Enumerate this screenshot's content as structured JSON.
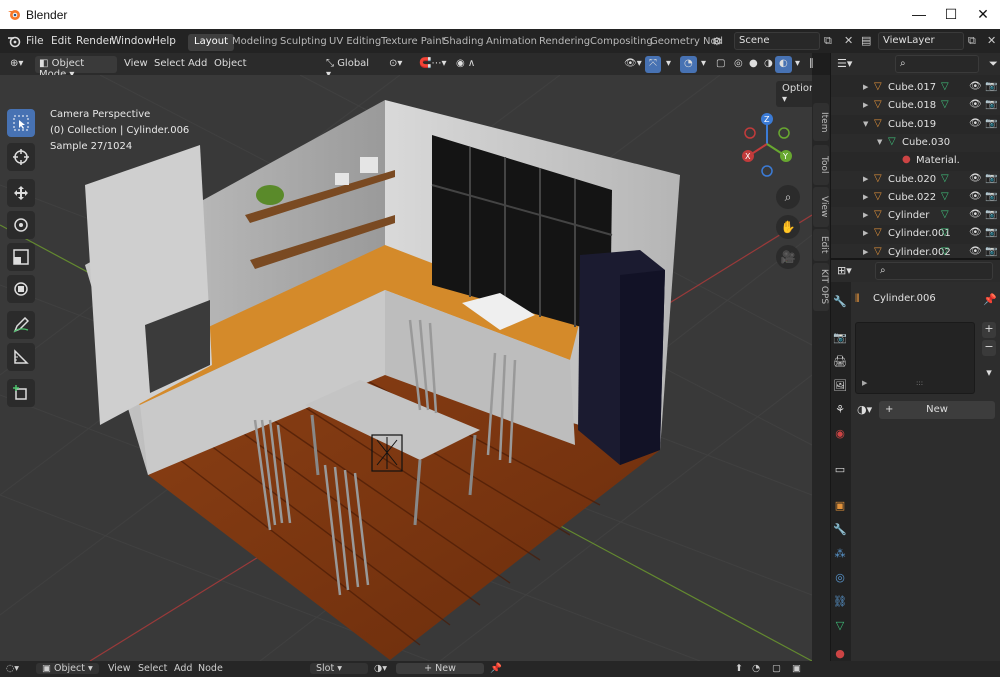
{
  "window": {
    "title": "Blender",
    "minimize": "—",
    "maximize": "☐",
    "close": "✕"
  },
  "menu": [
    "File",
    "Edit",
    "Render",
    "Window",
    "Help"
  ],
  "workspaces": [
    "Layout",
    "Modeling",
    "Sculpting",
    "UV Editing",
    "Texture Paint",
    "Shading",
    "Animation",
    "Rendering",
    "Compositing",
    "Geometry Nod"
  ],
  "scene": {
    "label": "Scene"
  },
  "view_layer": {
    "label": "ViewLayer"
  },
  "header": {
    "mode": "Object Mode",
    "view": "View",
    "select": "Select",
    "add": "Add",
    "object": "Object",
    "orientation": "Global",
    "options": "Options"
  },
  "overlay": {
    "line1": "Camera Perspective",
    "line2": "(0) Collection | Cylinder.006",
    "line3": "Sample 27/1024"
  },
  "side_tabs": [
    "Item",
    "Tool",
    "View",
    "Edit",
    "KIT OPS"
  ],
  "outliner": {
    "rows": [
      {
        "name": "Cube.017",
        "expanded": false,
        "indent": 0,
        "kind": "mesh"
      },
      {
        "name": "Cube.018",
        "expanded": false,
        "indent": 0,
        "kind": "mesh"
      },
      {
        "name": "Cube.019",
        "expanded": true,
        "indent": 0,
        "kind": "mesh"
      },
      {
        "name": "Cube.030",
        "expanded": true,
        "indent": 1,
        "kind": "data"
      },
      {
        "name": "Material.",
        "expanded": false,
        "indent": 2,
        "kind": "material"
      },
      {
        "name": "Cube.020",
        "expanded": false,
        "indent": 0,
        "kind": "mesh"
      },
      {
        "name": "Cube.022",
        "expanded": false,
        "indent": 0,
        "kind": "mesh"
      },
      {
        "name": "Cylinder",
        "expanded": false,
        "indent": 0,
        "kind": "mesh"
      },
      {
        "name": "Cylinder.001",
        "expanded": false,
        "indent": 0,
        "kind": "mesh"
      },
      {
        "name": "Cylinder.002",
        "expanded": false,
        "indent": 0,
        "kind": "mesh"
      }
    ]
  },
  "properties": {
    "object_name": "Cylinder.006",
    "new_label": "New"
  },
  "bottom": {
    "mode": "Object",
    "view": "View",
    "select": "Select",
    "add": "Add",
    "node": "Node",
    "slot": "Slot",
    "new": "New"
  },
  "colors": {
    "accent": "#4772b3",
    "mesh_icon": "#e0913a",
    "data_icon": "#3fbf7a"
  }
}
